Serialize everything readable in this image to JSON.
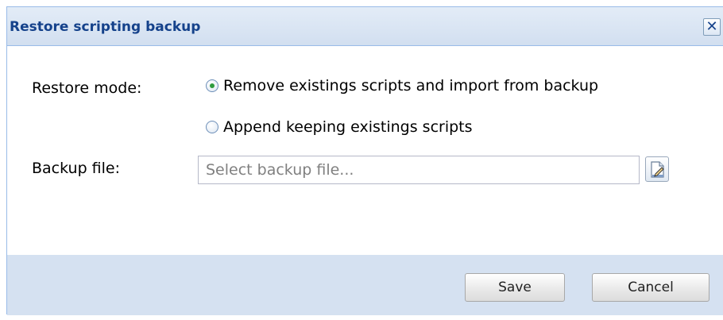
{
  "dialog": {
    "title": "Restore scripting backup",
    "close_glyph": "✕"
  },
  "form": {
    "restore_mode_label": "Restore mode:",
    "restore_mode_options": [
      {
        "label": "Remove existings scripts and import from backup",
        "selected": true
      },
      {
        "label": "Append keeping existings scripts",
        "selected": false
      }
    ],
    "backup_file_label": "Backup file:",
    "backup_file_value": "",
    "backup_file_placeholder": "Select backup file..."
  },
  "buttons": {
    "save_label": "Save",
    "cancel_label": "Cancel"
  },
  "icons": {
    "close": "close-icon",
    "browse": "file-edit-icon"
  },
  "colors": {
    "title_text": "#15428b",
    "header_bg": "#d2dff0",
    "footer_bg": "#d5e1f1",
    "border": "#99bbe8",
    "radio_dot": "#2f9b3e"
  }
}
